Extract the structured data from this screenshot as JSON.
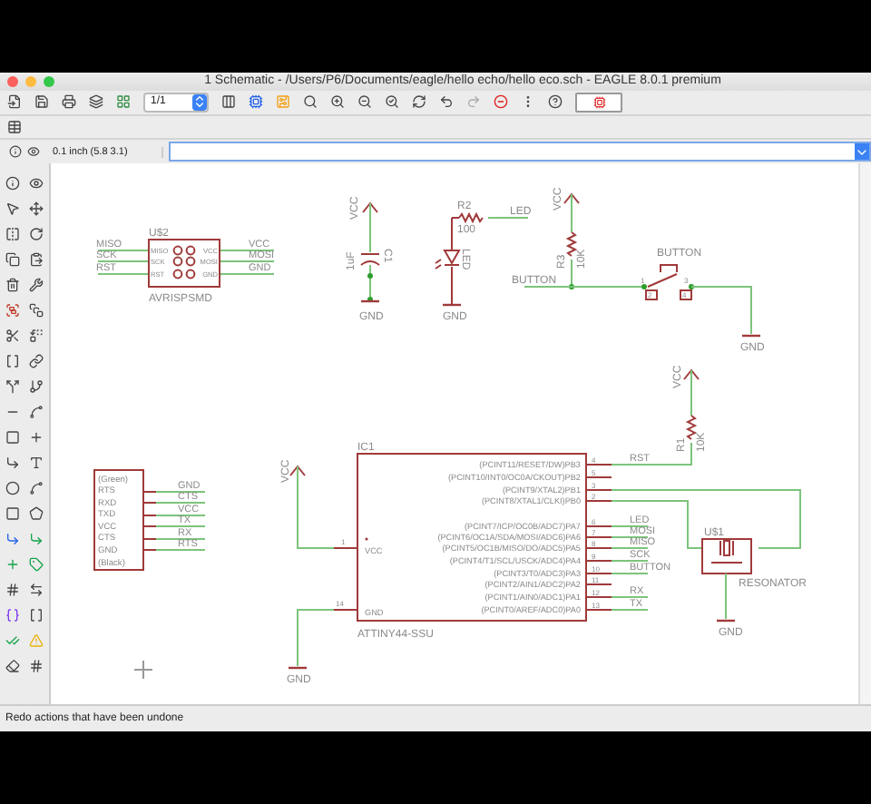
{
  "window": {
    "title": "1 Schematic - /Users/P6/Documents/eagle/hello echo/hello eco.sch - EAGLE 8.0.1 premium"
  },
  "toolbar": {
    "zoom": "1/1"
  },
  "command_bar": {
    "grid_info": "0.1 inch (5.8 3.1)"
  },
  "schematic": {
    "isp_header": {
      "name": "U$2",
      "value": "AVRISPSMD",
      "left_pins": [
        {
          "name": "MISO",
          "net": "MISO"
        },
        {
          "name": "SCK",
          "net": "SCK"
        },
        {
          "name": "RST",
          "net": "RST"
        }
      ],
      "right_pins": [
        {
          "name": "VCC",
          "net": "VCC"
        },
        {
          "name": "MOSI",
          "net": "MOSI"
        },
        {
          "name": "GND",
          "net": "GND"
        }
      ]
    },
    "capacitor": {
      "name": "C1",
      "value": "1uF",
      "supply": "VCC",
      "ground": "GND"
    },
    "led": {
      "resistor_name": "R2",
      "resistor_value": "100",
      "net": "LED",
      "diode_label": "LED",
      "ground": "GND"
    },
    "button_pullup": {
      "supply": "VCC",
      "name": "R3",
      "value": "10K",
      "net": "BUTTON"
    },
    "switch": {
      "name": "BUTTON",
      "pins": [
        "1",
        "2",
        "3",
        "4"
      ],
      "ground": "GND"
    },
    "reset_pullup": {
      "supply": "VCC",
      "name": "R1",
      "value": "10K"
    },
    "ic": {
      "name": "IC1",
      "value": "ATTINY44-SSU",
      "supply": "VCC",
      "supply_pin": "1",
      "supply_pin_name": "VCC",
      "ground": "GND",
      "ground_pin": "14",
      "ground_pin_name": "GND",
      "pins": [
        {
          "number": "4",
          "name": "(PCINT11/RESET/DW)PB3",
          "net": "RST"
        },
        {
          "number": "5",
          "name": "(PCINT10/INT0/OC0A/CKOUT)PB2"
        },
        {
          "number": "3",
          "name": "(PCINT9/XTAL2)PB1"
        },
        {
          "number": "2",
          "name": "(PCINT8/XTAL1/CLKI)PB0"
        },
        {
          "number": "6",
          "name": "(PCINT7/ICP/OC0B/ADC7)PA7",
          "net": "LED"
        },
        {
          "number": "7",
          "name": "(PCINT6/OC1A/SDA/MOSI/ADC6)PA6",
          "net": "MOSI"
        },
        {
          "number": "8",
          "name": "(PCINT5/OC1B/MISO/DO/ADC5)PA5",
          "net": "MISO"
        },
        {
          "number": "9",
          "name": "(PCINT4/T1/SCL/USCK/ADC4)PA4",
          "net": "SCK"
        },
        {
          "number": "10",
          "name": "(PCINT3/T0/ADC3)PA3",
          "net": "BUTTON"
        },
        {
          "number": "11",
          "name": "(PCINT2/AIN1/ADC2)PA2"
        },
        {
          "number": "12",
          "name": "(PCINT1/AIN0/ADC1)PA1",
          "net": "RX"
        },
        {
          "number": "13",
          "name": "(PCINT0/AREF/ADC0)PA0",
          "net": "TX"
        }
      ]
    },
    "resonator": {
      "name": "U$1",
      "value": "RESONATOR",
      "ground": "GND"
    },
    "ftdi": {
      "pins": [
        "(Green)",
        "RTS",
        "RXD",
        "TXD",
        "VCC",
        "CTS",
        "GND",
        "(Black)"
      ],
      "nets": [
        "GND",
        "CTS",
        "VCC",
        "TX",
        "RX",
        "RTS"
      ]
    }
  },
  "status_bar": {
    "text": "Redo actions that have been undone"
  }
}
